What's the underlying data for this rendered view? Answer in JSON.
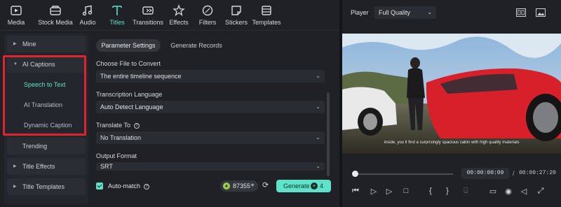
{
  "toolbar": {
    "items": [
      {
        "label": "Media",
        "icon": "media-icon"
      },
      {
        "label": "Stock Media",
        "icon": "stock-media-icon"
      },
      {
        "label": "Audio",
        "icon": "audio-icon"
      },
      {
        "label": "Titles",
        "icon": "titles-icon",
        "active": true
      },
      {
        "label": "Transitions",
        "icon": "transitions-icon"
      },
      {
        "label": "Effects",
        "icon": "effects-icon"
      },
      {
        "label": "Filters",
        "icon": "filters-icon"
      },
      {
        "label": "Stickers",
        "icon": "stickers-icon"
      },
      {
        "label": "Templates",
        "icon": "templates-icon"
      }
    ]
  },
  "sidebar": {
    "mine": "Mine",
    "ai_captions": "AI Captions",
    "speech_to_text": "Speech to Text",
    "ai_translation": "AI Translation",
    "dynamic_caption": "Dynamic Caption",
    "trending": "Trending",
    "title_effects": "Title Effects",
    "title_templates": "Title Templates"
  },
  "tabs": {
    "parameter_settings": "Parameter Settings",
    "generate_records": "Generate Records"
  },
  "form": {
    "file_label": "Choose File to Convert",
    "file_value": "The entire timeline sequence",
    "language_label": "Transcription Language",
    "language_value": "Auto Detect Language",
    "translate_label": "Translate To",
    "translate_value": "No Translation",
    "format_label": "Output Format",
    "format_value": "SRT"
  },
  "footer": {
    "automatch": "Auto-match",
    "credits": "87355",
    "generate": "Generate",
    "generate_cost": "4"
  },
  "player": {
    "label": "Player",
    "quality": "Full Quality",
    "subtitle": "inside, you ll find a surprisingly spacious cabin with high quality materials",
    "current_time": "00:00:00:09",
    "separator": "/",
    "total_time": "00:00:27:20"
  },
  "colors": {
    "accent": "#5fe3c8",
    "highlight_box": "#e0242b"
  }
}
